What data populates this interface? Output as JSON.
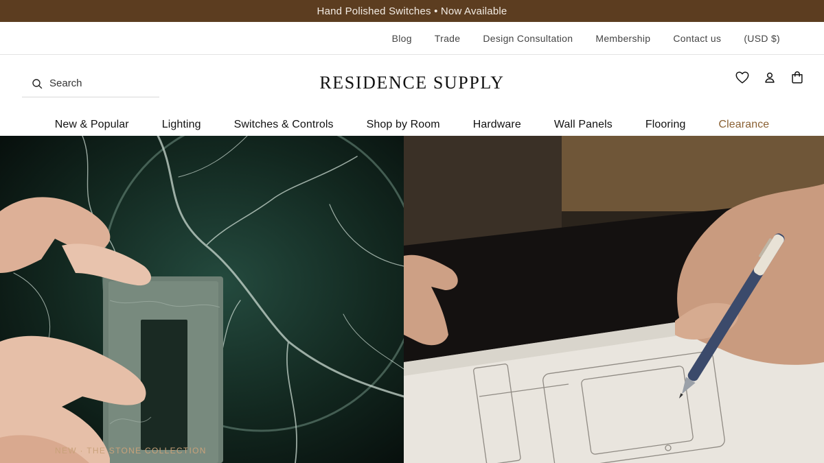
{
  "announcement": "Hand Polished Switches • Now Available",
  "utility_nav": [
    {
      "label": "Blog"
    },
    {
      "label": "Trade"
    },
    {
      "label": "Design Consultation"
    },
    {
      "label": "Membership"
    },
    {
      "label": "Contact us"
    },
    {
      "label": "(USD $)"
    }
  ],
  "search": {
    "placeholder": "Search",
    "icon": "search-icon"
  },
  "brand": {
    "name": "RESIDENCE SUPPLY"
  },
  "header_icons": [
    "heart-icon",
    "account-icon",
    "cart-icon"
  ],
  "main_nav": [
    {
      "label": "New & Popular"
    },
    {
      "label": "Lighting"
    },
    {
      "label": "Switches & Controls"
    },
    {
      "label": "Shop by Room"
    },
    {
      "label": "Hardware"
    },
    {
      "label": "Wall Panels"
    },
    {
      "label": "Flooring"
    },
    {
      "label": "Clearance"
    }
  ],
  "hero": {
    "caption": "NEW · THE STONE COLLECTION"
  },
  "colors": {
    "announcement_bg": "#5c3d20",
    "clearance_accent": "#8a6033",
    "caption": "#c9a27a"
  }
}
